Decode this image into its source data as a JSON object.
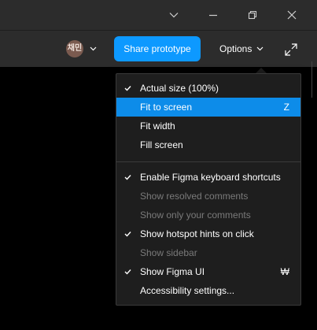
{
  "window_controls": {
    "collapse_icon": "chevron-down-icon",
    "minimize_icon": "minimize-icon",
    "restore_icon": "restore-icon",
    "close_icon": "close-icon"
  },
  "toolbar": {
    "avatar_initials": "채민",
    "share_label": "Share prototype",
    "options_label": "Options",
    "expand_icon": "expand-icon"
  },
  "colors": {
    "accent": "#0d99ff",
    "menu_highlight": "#0d8ce9",
    "menu_bg": "#1e1e1e",
    "toolbar_bg": "#2c2c2c",
    "disabled_text": "#7a7a7a"
  },
  "menu": {
    "items": [
      {
        "label": "Actual size (100%)",
        "checked": true,
        "disabled": false,
        "highlighted": false,
        "shortcut": ""
      },
      {
        "label": "Fit to screen",
        "checked": false,
        "disabled": false,
        "highlighted": true,
        "shortcut": "Z"
      },
      {
        "label": "Fit width",
        "checked": false,
        "disabled": false,
        "highlighted": false,
        "shortcut": ""
      },
      {
        "label": "Fill screen",
        "checked": false,
        "disabled": false,
        "highlighted": false,
        "shortcut": ""
      },
      {
        "label": "Enable Figma keyboard shortcuts",
        "checked": true,
        "disabled": false,
        "highlighted": false,
        "shortcut": ""
      },
      {
        "label": "Show resolved comments",
        "checked": false,
        "disabled": true,
        "highlighted": false,
        "shortcut": ""
      },
      {
        "label": "Show only your comments",
        "checked": false,
        "disabled": true,
        "highlighted": false,
        "shortcut": ""
      },
      {
        "label": "Show hotspot hints on click",
        "checked": true,
        "disabled": false,
        "highlighted": false,
        "shortcut": ""
      },
      {
        "label": "Show sidebar",
        "checked": false,
        "disabled": true,
        "highlighted": false,
        "shortcut": ""
      },
      {
        "label": "Show Figma UI",
        "checked": true,
        "disabled": false,
        "highlighted": false,
        "shortcut": "₩"
      },
      {
        "label": "Accessibility settings...",
        "checked": false,
        "disabled": false,
        "highlighted": false,
        "shortcut": ""
      }
    ]
  }
}
